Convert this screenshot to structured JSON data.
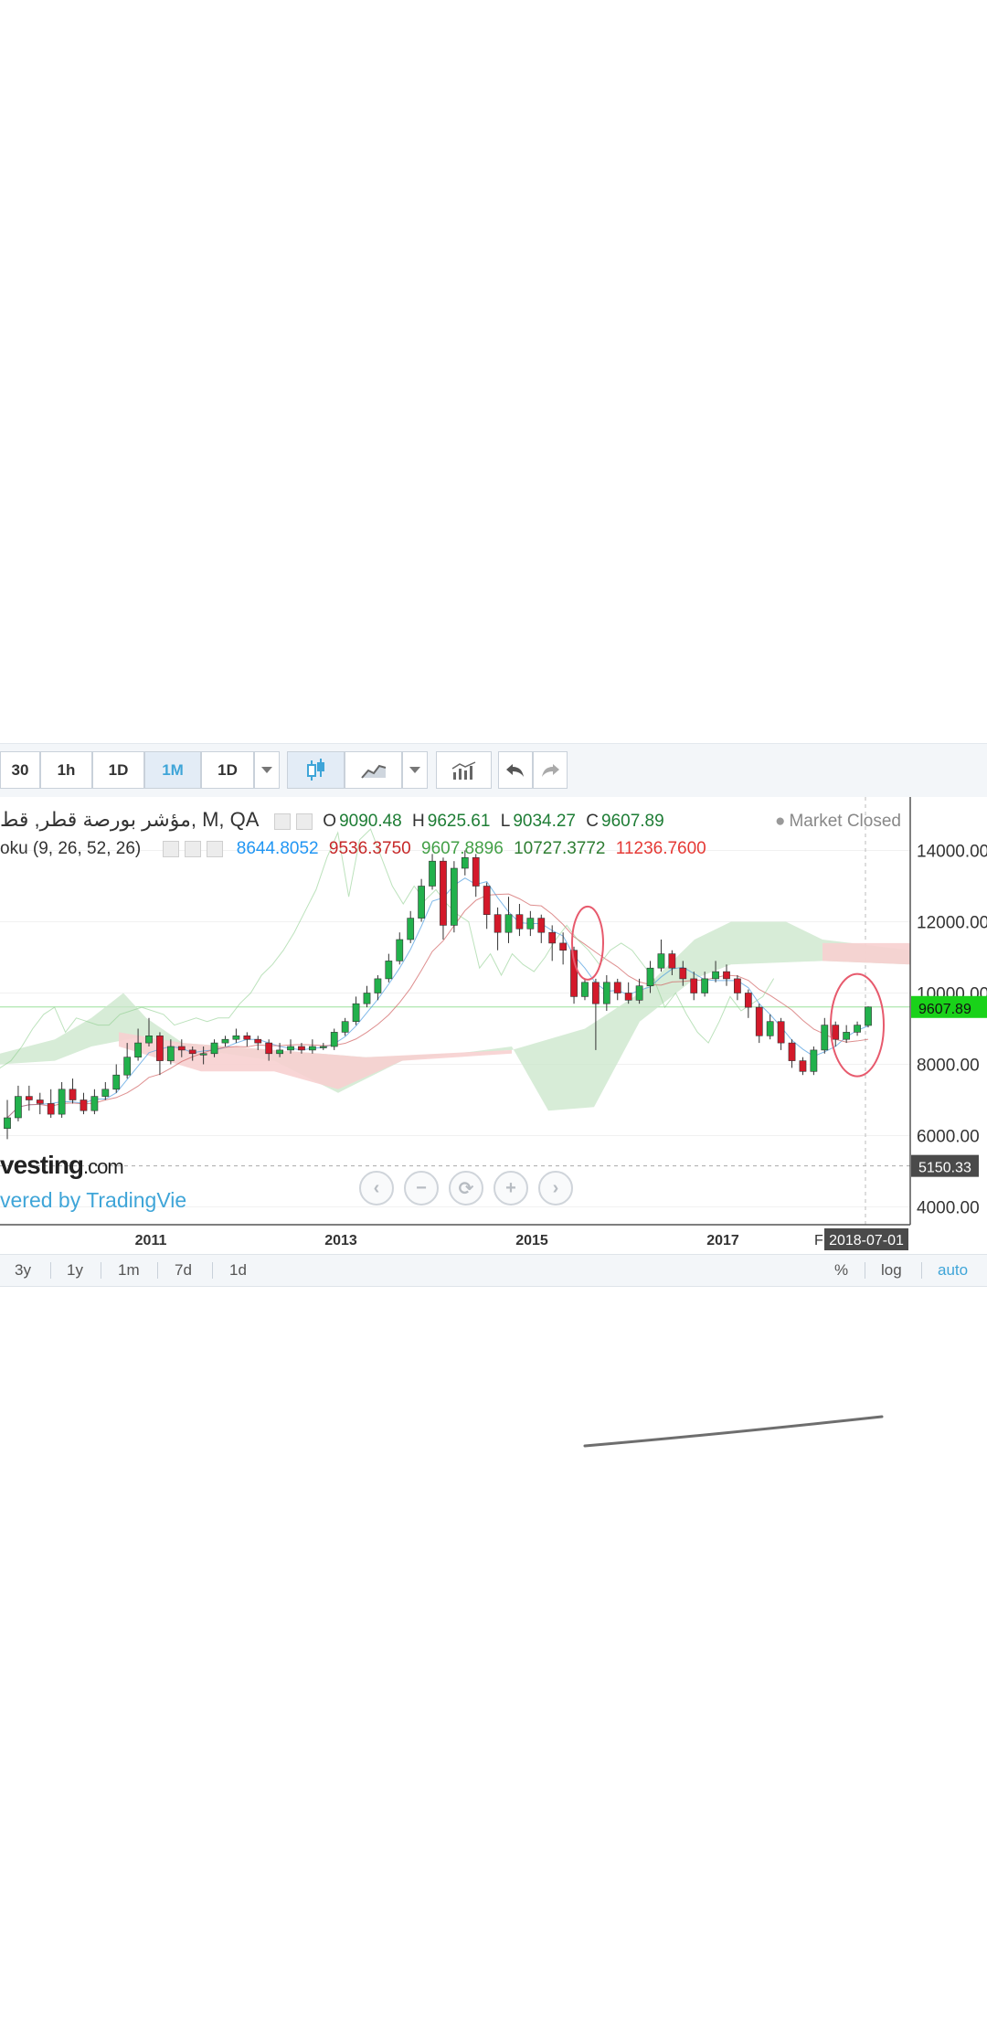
{
  "toolbar": {
    "intervals": [
      "30",
      "1h",
      "1D",
      "1M",
      "1D"
    ],
    "active_interval": "1M"
  },
  "legend": {
    "symbol": "مؤشر بورصة قطر, قط",
    "symbol_suffix": ", M, QA",
    "o_label": "O",
    "o_value": "9090.48",
    "h_label": "H",
    "h_value": "9625.61",
    "l_label": "L",
    "l_value": "9034.27",
    "c_label": "C",
    "c_value": "9607.89",
    "market_status": "Market Closed",
    "indicator": "oku (9, 26, 52, 26)",
    "ind_values": [
      "8644.8052",
      "9536.3750",
      "9607.8896",
      "10727.3772",
      "11236.7600"
    ],
    "ind_colors": [
      "#2196f3",
      "#c62828",
      "#43a047",
      "#2e7d32",
      "#e53935"
    ]
  },
  "price_axis": {
    "ticks": [
      "14000.00",
      "12000.00",
      "10000.00",
      "8000.00",
      "6000.00",
      "4000.00"
    ],
    "current_price": "9607.89",
    "crosshair_price": "5150.33"
  },
  "time_axis": {
    "ticks": [
      "2011",
      "2013",
      "2015",
      "2017"
    ],
    "crosshair_date": "2018-07-01",
    "crosshair_prefix": "F"
  },
  "watermark": {
    "brand": "vesting",
    "brand_suffix": ".com",
    "powered": "vered by TradingVie"
  },
  "bottombar": {
    "ranges": [
      "3y",
      "1y",
      "1m",
      "7d",
      "1d"
    ],
    "right": [
      "%",
      "log",
      "auto"
    ]
  },
  "colors": {
    "up": "#22b14c",
    "down": "#d3192a",
    "cloud_green": "#c9e6c9",
    "cloud_red": "#f7d0d0",
    "accent": "#3fa5d8",
    "price_tag": "#19d219"
  },
  "chart_data": {
    "type": "candlestick",
    "x_ticks": [
      "2011",
      "2013",
      "2015",
      "2017"
    ],
    "ylim": [
      3500,
      15500
    ],
    "y_ticks": [
      4000,
      6000,
      8000,
      10000,
      12000,
      14000
    ],
    "candles": [
      [
        6200,
        6500,
        7000,
        5900
      ],
      [
        6500,
        7100,
        7400,
        6400
      ],
      [
        7100,
        7000,
        7400,
        6700
      ],
      [
        7000,
        6900,
        7200,
        6600
      ],
      [
        6900,
        6600,
        7300,
        6500
      ],
      [
        6600,
        7300,
        7500,
        6500
      ],
      [
        7300,
        7000,
        7600,
        6900
      ],
      [
        7000,
        6700,
        7200,
        6600
      ],
      [
        6700,
        7100,
        7300,
        6600
      ],
      [
        7100,
        7300,
        7500,
        7000
      ],
      [
        7300,
        7700,
        8000,
        7200
      ],
      [
        7700,
        8200,
        8600,
        7600
      ],
      [
        8200,
        8600,
        9000,
        8100
      ],
      [
        8600,
        8800,
        9300,
        8500
      ],
      [
        8800,
        8100,
        8900,
        7700
      ],
      [
        8100,
        8500,
        8700,
        8000
      ],
      [
        8500,
        8400,
        8700,
        8200
      ],
      [
        8400,
        8300,
        8500,
        8100
      ],
      [
        8300,
        8300,
        8500,
        8000
      ],
      [
        8300,
        8600,
        8700,
        8200
      ],
      [
        8600,
        8700,
        8800,
        8500
      ],
      [
        8700,
        8800,
        9000,
        8600
      ],
      [
        8800,
        8700,
        8900,
        8500
      ],
      [
        8700,
        8600,
        8800,
        8400
      ],
      [
        8600,
        8300,
        8700,
        8100
      ],
      [
        8300,
        8400,
        8600,
        8200
      ],
      [
        8400,
        8500,
        8700,
        8300
      ],
      [
        8500,
        8400,
        8600,
        8300
      ],
      [
        8400,
        8500,
        8700,
        8300
      ],
      [
        8500,
        8500,
        8600,
        8400
      ],
      [
        8500,
        8900,
        9000,
        8400
      ],
      [
        8900,
        9200,
        9300,
        8800
      ],
      [
        9200,
        9700,
        9900,
        9100
      ],
      [
        9700,
        10000,
        10200,
        9600
      ],
      [
        10000,
        10400,
        10500,
        9800
      ],
      [
        10400,
        10900,
        11100,
        10300
      ],
      [
        10900,
        11500,
        11700,
        10800
      ],
      [
        11500,
        12100,
        12300,
        11400
      ],
      [
        12100,
        13000,
        13200,
        12000
      ],
      [
        13000,
        13700,
        13900,
        12900
      ],
      [
        13700,
        11900,
        13800,
        11500
      ],
      [
        11900,
        13500,
        13700,
        11700
      ],
      [
        13500,
        13800,
        14000,
        13300
      ],
      [
        13800,
        13000,
        13900,
        12700
      ],
      [
        13000,
        12200,
        13100,
        11800
      ],
      [
        12200,
        11700,
        12400,
        11200
      ],
      [
        11700,
        12200,
        12700,
        11400
      ],
      [
        12200,
        11800,
        12500,
        11600
      ],
      [
        11800,
        12100,
        12300,
        11600
      ],
      [
        12100,
        11700,
        12200,
        11400
      ],
      [
        11700,
        11400,
        11900,
        10900
      ],
      [
        11400,
        11200,
        11700,
        10800
      ],
      [
        11200,
        9900,
        11300,
        9700
      ],
      [
        9900,
        10300,
        10400,
        9800
      ],
      [
        10300,
        9700,
        10400,
        8400
      ],
      [
        9700,
        10300,
        10500,
        9500
      ],
      [
        10300,
        10000,
        10400,
        9800
      ],
      [
        10000,
        9800,
        10300,
        9700
      ],
      [
        9800,
        10200,
        10400,
        9700
      ],
      [
        10200,
        10700,
        10900,
        10000
      ],
      [
        10700,
        11100,
        11500,
        10600
      ],
      [
        11100,
        10700,
        11200,
        10500
      ],
      [
        10700,
        10400,
        10900,
        10200
      ],
      [
        10400,
        10000,
        10600,
        9800
      ],
      [
        10000,
        10400,
        10600,
        9900
      ],
      [
        10400,
        10600,
        10900,
        10300
      ],
      [
        10600,
        10400,
        10800,
        10200
      ],
      [
        10400,
        10000,
        10500,
        9800
      ],
      [
        10000,
        9600,
        10100,
        9300
      ],
      [
        9600,
        8800,
        9700,
        8600
      ],
      [
        8800,
        9200,
        9400,
        8700
      ],
      [
        9200,
        8600,
        9300,
        8400
      ],
      [
        8600,
        8100,
        8700,
        7900
      ],
      [
        8100,
        7800,
        8200,
        7700
      ],
      [
        7800,
        8400,
        8500,
        7700
      ],
      [
        8400,
        9100,
        9300,
        8300
      ],
      [
        9100,
        8700,
        9200,
        8500
      ],
      [
        8700,
        8900,
        9100,
        8600
      ],
      [
        8900,
        9100,
        9200,
        8800
      ],
      [
        9090,
        9608,
        9626,
        9034
      ]
    ]
  }
}
